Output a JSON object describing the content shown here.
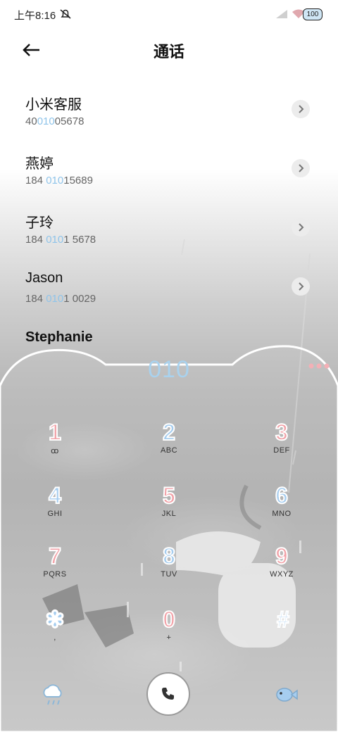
{
  "status_bar": {
    "time": "上午8:16",
    "battery": "100"
  },
  "header": {
    "title": "通话"
  },
  "contacts": [
    {
      "name": "小米客服",
      "number_pre": "40",
      "number_match": "010",
      "number_post": "05678"
    },
    {
      "name": "燕婷",
      "number_pre": "184 ",
      "number_match": "010",
      "number_post": "15689"
    },
    {
      "name": "子玲",
      "number_pre": "184 ",
      "number_match": "010",
      "number_post": "1 5678"
    },
    {
      "name": "Jason",
      "number_pre": "184 ",
      "number_match": "010",
      "number_post": "1 0029"
    },
    {
      "name": "Stephanie"
    }
  ],
  "dialer": {
    "entered": "010",
    "keys": [
      {
        "digit": "1",
        "letters": "ꝏ",
        "color": "pink"
      },
      {
        "digit": "2",
        "letters": "ABC",
        "color": "blue"
      },
      {
        "digit": "3",
        "letters": "DEF",
        "color": "pink"
      },
      {
        "digit": "4",
        "letters": "GHI",
        "color": "blue"
      },
      {
        "digit": "5",
        "letters": "JKL",
        "color": "pink"
      },
      {
        "digit": "6",
        "letters": "MNO",
        "color": "blue"
      },
      {
        "digit": "7",
        "letters": "PQRS",
        "color": "pink"
      },
      {
        "digit": "8",
        "letters": "TUV",
        "color": "blue"
      },
      {
        "digit": "9",
        "letters": "WXYZ",
        "color": "pink"
      },
      {
        "digit": "✽",
        "letters": ",",
        "color": "blue"
      },
      {
        "digit": "0",
        "letters": "+",
        "color": "pink"
      },
      {
        "digit": "#",
        "letters": "",
        "color": "blue"
      }
    ]
  },
  "colors": {
    "accent_blue": "#a6cdef",
    "accent_pink": "#f2a2a8",
    "match_highlight": "#8fc4ea"
  }
}
